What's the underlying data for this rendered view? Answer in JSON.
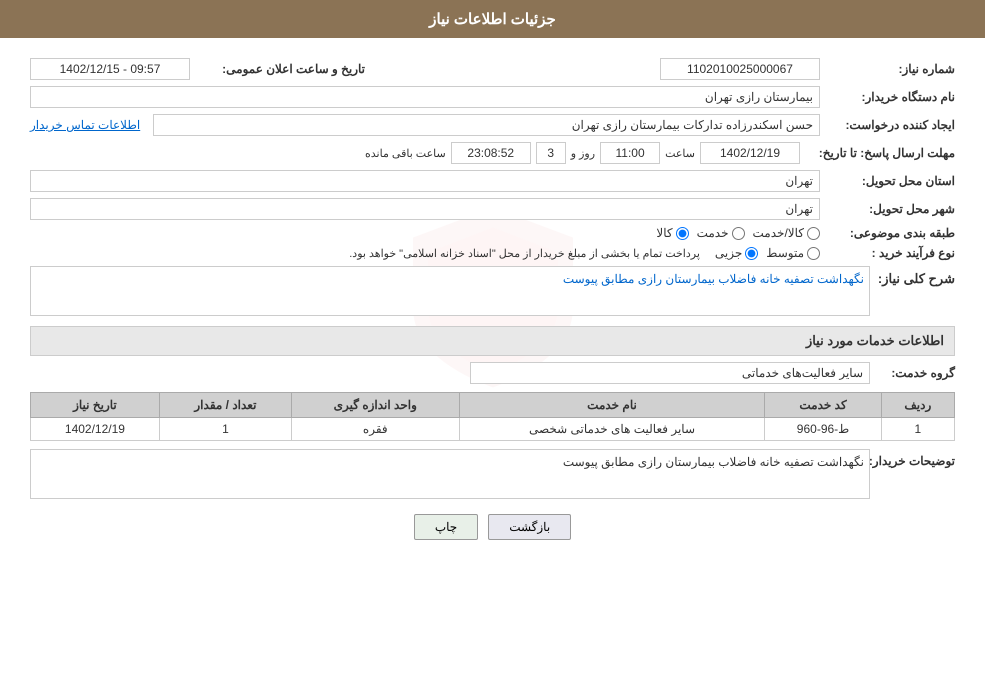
{
  "header": {
    "title": "جزئیات اطلاعات نیاز"
  },
  "fields": {
    "shomara_niaz_label": "شماره نیاز:",
    "shomara_niaz_value": "1102010025000067",
    "nam_dastgah_label": "نام دستگاه خریدار:",
    "nam_dastgah_value": "بیمارستان رازی تهران",
    "tarikh_label": "تاریخ و ساعت اعلان عمومی:",
    "tarikh_value": "1402/12/15 - 09:57",
    "ejad_label": "ایجاد کننده درخواست:",
    "ejad_value": "حسن اسکندرزاده تدارکات بیمارستان رازی تهران",
    "contact_link": "اطلاعات تماس خریدار",
    "mohlat_label": "مهلت ارسال پاسخ: تا تاریخ:",
    "mohlat_date": "1402/12/19",
    "mohlat_saat_label": "ساعت",
    "mohlat_saat": "11:00",
    "mohlat_rooz_label": "روز و",
    "mohlat_rooz": "3",
    "mohlat_baqi_label": "ساعت باقی مانده",
    "mohlat_baqi_value": "23:08:52",
    "ostan_label": "استان محل تحویل:",
    "ostan_value": "تهران",
    "shahr_label": "شهر محل تحویل:",
    "shahr_value": "تهران",
    "tabaqe_label": "طبقه بندی موضوعی:",
    "tabaqe_kala": "کالا",
    "tabaqe_khadamat": "خدمت",
    "tabaqe_kala_khadamat": "کالا/خدمت",
    "noue_label": "نوع فرآیند خرید :",
    "noue_jazii": "جزیی",
    "noue_motovaset": "متوسط",
    "noue_text": "پرداخت تمام یا بخشی از مبلغ خریدار از محل \"اسناد خزانه اسلامی\" خواهد بود.",
    "sharh_label": "شرح کلی نیاز:",
    "sharh_value": "نگهداشت تصفیه خانه فاضلاب بیمارستان رازی مطابق پیوست",
    "info_header": "اطلاعات خدمات مورد نیاز",
    "group_label": "گروه خدمت:",
    "group_value": "سایر فعالیت‌های خدماتی",
    "table": {
      "headers": [
        "ردیف",
        "کد خدمت",
        "نام خدمت",
        "واحد اندازه گیری",
        "تعداد / مقدار",
        "تاریخ نیاز"
      ],
      "rows": [
        {
          "radif": "1",
          "kod_khadamat": "ط-96-960",
          "nam_khadamat": "سایر فعالیت های خدماتی شخصی",
          "vahed": "فقره",
          "tedad": "1",
          "tarikh": "1402/12/19"
        }
      ]
    },
    "tosih_label": "توضیحات خریدار:",
    "tosih_value": "نگهداشت تصفیه خانه فاضلاب بیمارستان رازی مطابق پیوست"
  },
  "buttons": {
    "print": "چاپ",
    "back": "بازگشت"
  }
}
